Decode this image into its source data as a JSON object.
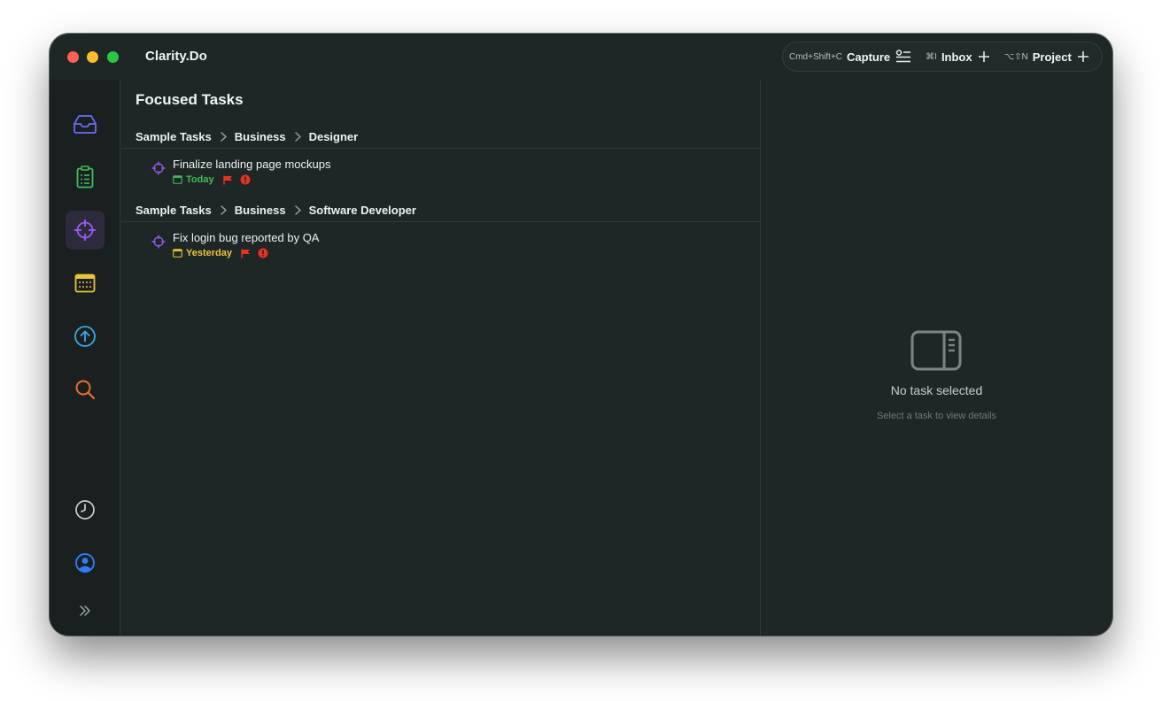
{
  "app": {
    "title": "Clarity.Do"
  },
  "toolbar": {
    "capture": {
      "shortcut": "Cmd+Shift+C",
      "label": "Capture"
    },
    "inbox": {
      "shortcut": "⌘I",
      "label": "Inbox"
    },
    "project": {
      "shortcut": "⌥⇧N",
      "label": "Project"
    }
  },
  "sidebar": {
    "items": [
      {
        "name": "inbox",
        "icon": "inbox-icon",
        "color": "#6b6ff0"
      },
      {
        "name": "tasks",
        "icon": "clipboard-list-icon",
        "color": "#3ebd5a"
      },
      {
        "name": "focused",
        "icon": "crosshair-icon",
        "color": "#9a5cf5",
        "active": true
      },
      {
        "name": "calendar",
        "icon": "calendar-icon",
        "color": "#e8c53a"
      },
      {
        "name": "upcoming",
        "icon": "arrow-up-circle-icon",
        "color": "#3aa8e8"
      },
      {
        "name": "search",
        "icon": "search-icon",
        "color": "#f07032"
      },
      {
        "name": "history",
        "icon": "clock-icon",
        "color": "#c9cece"
      },
      {
        "name": "account",
        "icon": "user-circle-icon",
        "color": "#2f7df2"
      },
      {
        "name": "expand",
        "icon": "double-chevron-right-icon",
        "color": "#9aa3a3"
      }
    ]
  },
  "main": {
    "title": "Focused Tasks",
    "groups": [
      {
        "path": [
          "Sample Tasks",
          "Business",
          "Designer"
        ],
        "tasks": [
          {
            "title": "Finalize landing page mockups",
            "due": "Today",
            "due_color": "#3ebd5a",
            "flag_color": "#e8321f",
            "alert_color": "#e8321f"
          }
        ]
      },
      {
        "path": [
          "Sample Tasks",
          "Business",
          "Software Developer"
        ],
        "tasks": [
          {
            "title": "Fix login bug reported by QA",
            "due": "Yesterday",
            "due_color": "#e8c53a",
            "flag_color": "#e8321f",
            "alert_color": "#e8321f"
          }
        ]
      }
    ]
  },
  "detail": {
    "empty_title": "No task selected",
    "empty_subtitle": "Select a task to view details"
  }
}
